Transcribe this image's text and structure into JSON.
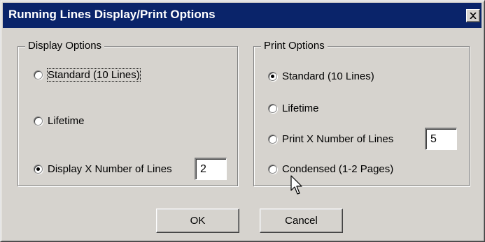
{
  "window": {
    "title": "Running Lines Display/Print Options",
    "close_icon": "close-icon"
  },
  "display_options": {
    "legend": "Display Options",
    "options": [
      {
        "label": "Standard (10 Lines)",
        "checked": false,
        "focused": true
      },
      {
        "label": "Lifetime",
        "checked": false,
        "focused": false
      },
      {
        "label": "Display X Number of Lines",
        "checked": true,
        "focused": false
      }
    ],
    "lines_value": "2"
  },
  "print_options": {
    "legend": "Print Options",
    "options": [
      {
        "label": "Standard (10 Lines)",
        "checked": true
      },
      {
        "label": "Lifetime",
        "checked": false
      },
      {
        "label": "Print X Number of Lines",
        "checked": false
      },
      {
        "label": "Condensed (1-2 Pages)",
        "checked": false
      }
    ],
    "lines_value": "5"
  },
  "buttons": {
    "ok": "OK",
    "cancel": "Cancel"
  },
  "colors": {
    "titlebar": "#0a246a",
    "face": "#d6d3ce"
  }
}
